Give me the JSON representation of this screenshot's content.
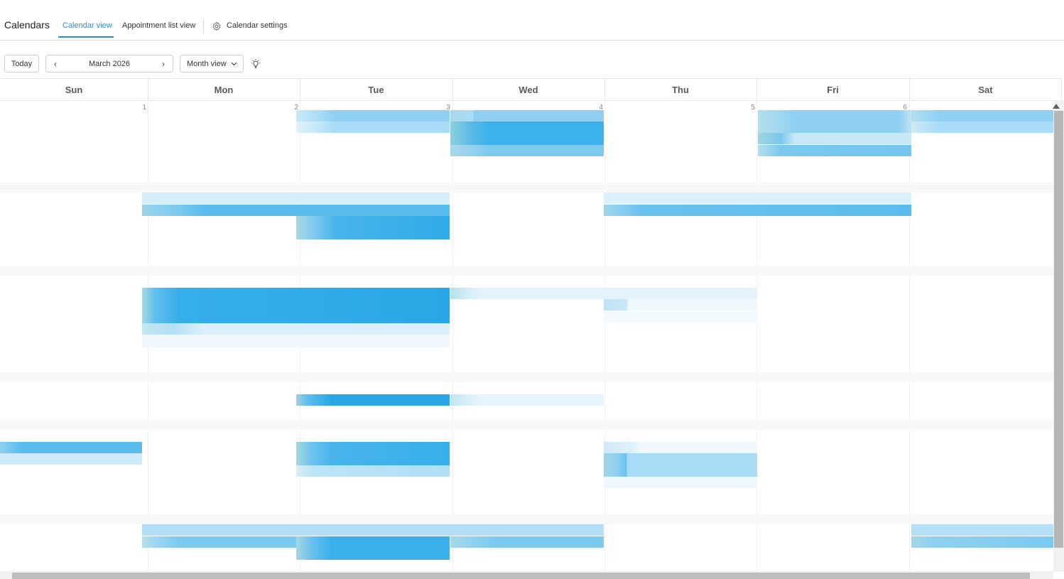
{
  "app": {
    "title": "Calendars"
  },
  "tabs": [
    {
      "label": "Calendar view",
      "active": true
    },
    {
      "label": "Appointment list view",
      "active": false
    },
    {
      "label": "Calendar settings",
      "active": false,
      "icon": "gear-icon"
    }
  ],
  "toolbar": {
    "today_label": "Today",
    "prev_icon": "chevron-left-icon",
    "month_label": "March 2026",
    "next_icon": "chevron-right-icon",
    "view_label": "Month view",
    "view_dropdown_icon": "chevron-down-icon",
    "theme_icon": "lightbulb-icon"
  },
  "calendar": {
    "days": [
      "Sun",
      "Mon",
      "Tue",
      "Wed",
      "Thu",
      "Fri",
      "Sat"
    ],
    "first_week_dates": [
      "1",
      "2",
      "3",
      "4",
      "5",
      "6"
    ]
  },
  "colors": {
    "accent": "#2a8fd0",
    "event_strong": "#2aa6e6",
    "event_medium": "#5cbcec",
    "event_light": "#9fd6f3",
    "event_faint": "#dcf0fb"
  }
}
